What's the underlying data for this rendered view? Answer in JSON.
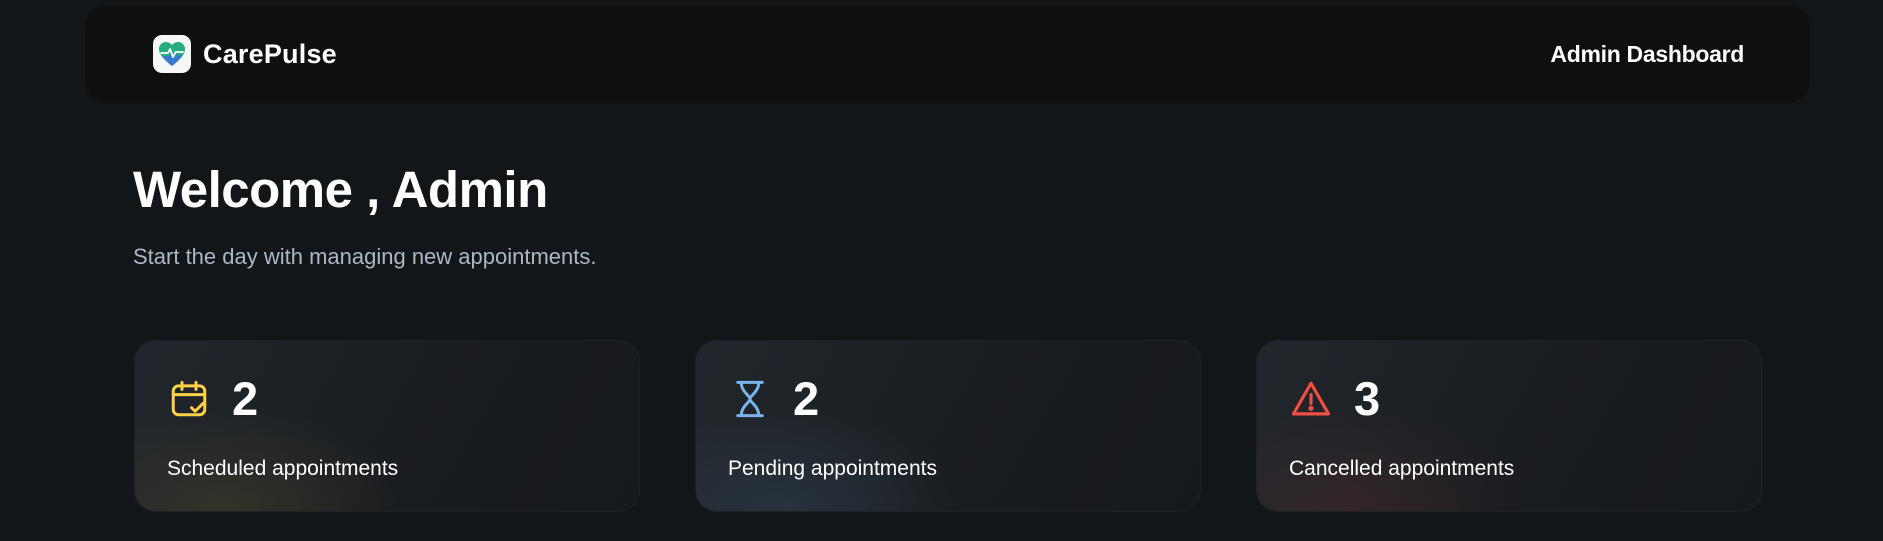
{
  "header": {
    "brand_name": "CarePulse",
    "title": "Admin Dashboard"
  },
  "main": {
    "welcome": "Welcome , Admin",
    "subtitle": "Start the day with managing new appointments."
  },
  "stats": [
    {
      "icon": "calendar-check-icon",
      "count": "2",
      "label": "Scheduled appointments",
      "color": "#FFD147"
    },
    {
      "icon": "hourglass-icon",
      "count": "2",
      "label": "Pending appointments",
      "color": "#79B5EC"
    },
    {
      "icon": "warning-triangle-icon",
      "count": "3",
      "label": "Cancelled appointments",
      "color": "#F24E43"
    }
  ],
  "colors": {
    "background": "#131619",
    "header_bg": "#0D0F10",
    "subtitle": "#ABB8C4"
  }
}
